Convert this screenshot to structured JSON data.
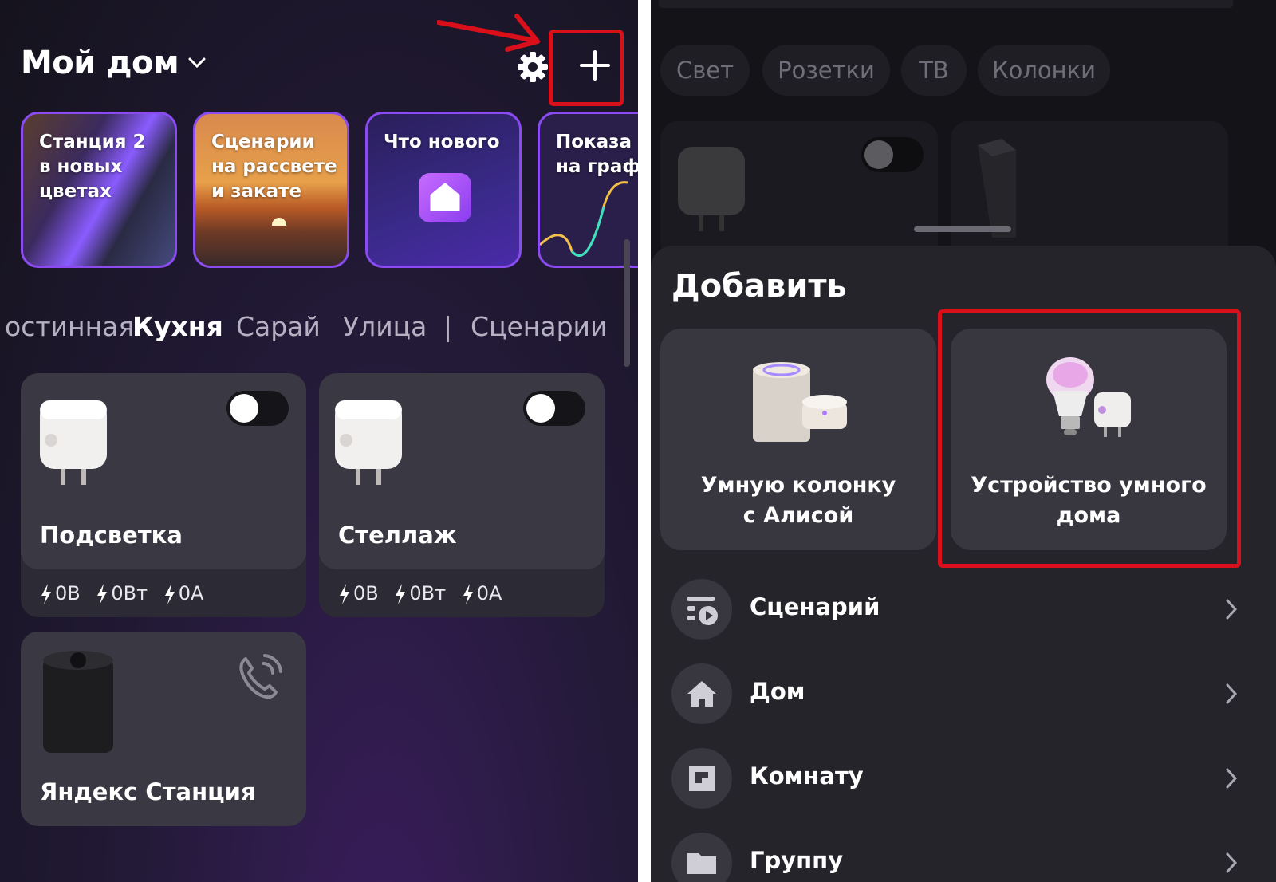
{
  "left": {
    "title": "Мой дом",
    "stories": [
      {
        "text": "Станция 2\nв новых\nцветах"
      },
      {
        "text": "Сценарии\nна рассвете\nи закате"
      },
      {
        "text": "Что нового"
      },
      {
        "text": "Показа\nна граф"
      }
    ],
    "tabs": [
      "остинная",
      "Кухня",
      "Сарай",
      "Улица",
      "|",
      "Сценарии"
    ],
    "devices": [
      {
        "name": "Подсветка",
        "voltage": "0В",
        "power": "0Вт",
        "current": "0А"
      },
      {
        "name": "Стеллаж",
        "voltage": "0В",
        "power": "0Вт",
        "current": "0А"
      },
      {
        "name": "Яндекс Станция"
      }
    ]
  },
  "right": {
    "filters": [
      "Свет",
      "Розетки",
      "ТВ",
      "Колонки"
    ],
    "sheet_title": "Добавить",
    "add_cards": [
      {
        "label": "Умную колонку\nс Алисой"
      },
      {
        "label": "Устройство умного\nдома"
      }
    ],
    "rows": [
      {
        "label": "Сценарий"
      },
      {
        "label": "Дом"
      },
      {
        "label": "Комнату"
      },
      {
        "label": "Группу"
      }
    ]
  },
  "colors": {
    "highlight": "#d90f1a",
    "accent": "#8a4cf0"
  },
  "icons": [
    "chevron-down-icon",
    "gear-icon",
    "plus-icon",
    "power-bolt-icon",
    "phone-call-icon",
    "scenario-icon",
    "house-icon",
    "room-icon",
    "folder-icon",
    "chevron-right-icon"
  ]
}
